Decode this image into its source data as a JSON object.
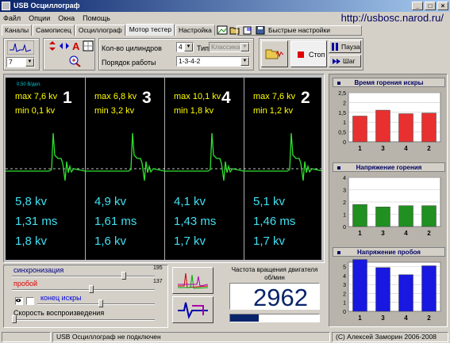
{
  "window": {
    "title": "USB Осциллограф",
    "url": "http://usbosc.narod.ru/"
  },
  "menu": [
    "Файл",
    "Опции",
    "Окна",
    "Помощь"
  ],
  "tabs": [
    {
      "label": "Каналы",
      "active": false
    },
    {
      "label": "Самописец",
      "active": false
    },
    {
      "label": "Осциллограф",
      "active": false
    },
    {
      "label": "Мотор тестер",
      "active": true
    },
    {
      "label": "Настройка",
      "active": false
    }
  ],
  "quick_settings": "Быстрые настройки",
  "toolbar": {
    "cylinders_label": "Кол-во цилиндров",
    "cylinders_value": "4",
    "type_label": "Тип",
    "type_value": "Классика",
    "order_label": "Порядок работы",
    "order_value": "1-3-4-2",
    "channel_value": "7",
    "stop_label": "Стоп",
    "pause_label": "Пауза",
    "step_label": "Шаг"
  },
  "scope": {
    "scale_label": "0.50 В/дел.",
    "cylinders": [
      {
        "num": "1",
        "max": "max 7,6 kv",
        "min": "min 0,1 kv",
        "v1": "5,8 kv",
        "v2": "1,31 ms",
        "v3": "1,8 kv"
      },
      {
        "num": "3",
        "max": "max 6,8 kv",
        "min": "min 3,2 kv",
        "v1": "4,9 kv",
        "v2": "1,61 ms",
        "v3": "1,6 kv"
      },
      {
        "num": "4",
        "max": "max 10,1 kv",
        "min": "min 1,8 kv",
        "v1": "4,1 kv",
        "v2": "1,43 ms",
        "v3": "1,7 kv"
      },
      {
        "num": "2",
        "max": "max 7,6 kv",
        "min": "min 1,2 kv",
        "v1": "5,1 kv",
        "v2": "1,46 ms",
        "v3": "1,7 kv"
      }
    ]
  },
  "controls": {
    "sync_label": "синхронизация",
    "sync_value": "195",
    "breakdown_label": "пробой",
    "breakdown_value": "137",
    "spark_end_label": "конец искры",
    "speed_label": "Скорость воспроизведения",
    "rpm_label": "Частота вращения двигателя\nоб/мин",
    "rpm_value": "2962"
  },
  "chart_data": [
    {
      "type": "bar",
      "title": "Время горения искры",
      "categories": [
        "1",
        "3",
        "4",
        "2"
      ],
      "values": [
        1.31,
        1.61,
        1.43,
        1.46
      ],
      "ylim": [
        0,
        2.5
      ],
      "yticks": [
        "0",
        "0,5",
        "1",
        "1,5",
        "2",
        "2,5"
      ],
      "color": "#e83030"
    },
    {
      "type": "bar",
      "title": "Напряжение горения",
      "categories": [
        "1",
        "3",
        "4",
        "2"
      ],
      "values": [
        1.8,
        1.6,
        1.7,
        1.7
      ],
      "ylim": [
        0,
        4
      ],
      "yticks": [
        "0",
        "1",
        "2",
        "3",
        "4"
      ],
      "color": "#209020"
    },
    {
      "type": "bar",
      "title": "Напряжение пробоя",
      "categories": [
        "1",
        "3",
        "4",
        "2"
      ],
      "values": [
        5.8,
        4.9,
        4.1,
        5.1
      ],
      "ylim": [
        0,
        5.5
      ],
      "yticks": [
        "0",
        "1",
        "2",
        "3",
        "4",
        "5"
      ],
      "color": "#1818e0"
    }
  ],
  "status": {
    "connection": "USB Осциллограф не подключен",
    "copyright": "(С) Алексей Заморин 2006-2008"
  }
}
